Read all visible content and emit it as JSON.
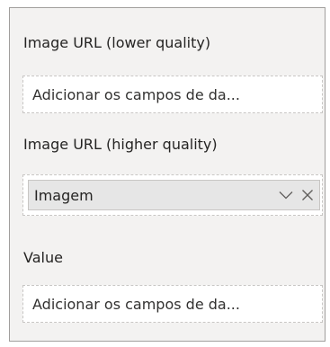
{
  "fields": [
    {
      "label": "Image URL (lower quality)",
      "placeholder": "Adicionar os campos de da..."
    },
    {
      "label": "Image URL (higher quality)",
      "chip": {
        "label": "Imagem",
        "expand_icon": "chevron-down-icon",
        "remove_icon": "close-icon"
      }
    },
    {
      "label": "Value",
      "placeholder": "Adicionar os campos de da..."
    }
  ]
}
